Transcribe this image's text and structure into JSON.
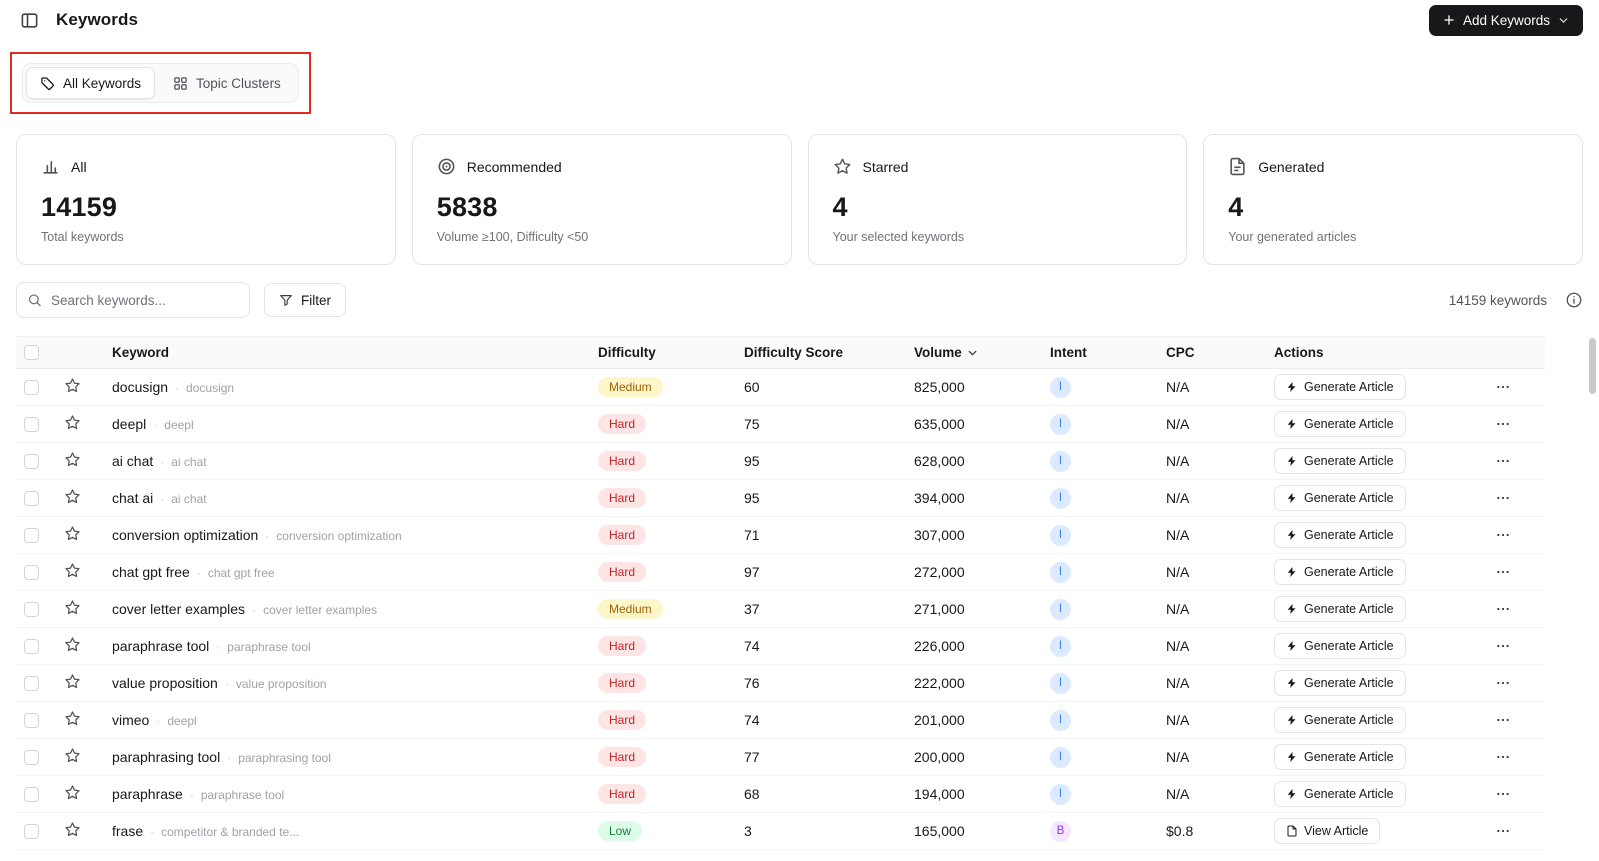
{
  "header": {
    "title": "Keywords",
    "add_keywords_label": "Add Keywords"
  },
  "view_tabs": {
    "all_keywords_label": "All Keywords",
    "topic_clusters_label": "Topic Clusters"
  },
  "stat_cards": [
    {
      "icon": "bar-chart-icon",
      "title": "All",
      "value": "14159",
      "subtitle": "Total keywords"
    },
    {
      "icon": "target-icon",
      "title": "Recommended",
      "value": "5838",
      "subtitle": "Volume ≥100, Difficulty <50"
    },
    {
      "icon": "star-icon",
      "title": "Starred",
      "value": "4",
      "subtitle": "Your selected keywords"
    },
    {
      "icon": "file-icon",
      "title": "Generated",
      "value": "4",
      "subtitle": "Your generated articles"
    }
  ],
  "toolbar": {
    "search_placeholder": "Search keywords...",
    "filter_label": "Filter",
    "keyword_count": "14159 keywords"
  },
  "table": {
    "headers": {
      "keyword": "Keyword",
      "difficulty": "Difficulty",
      "difficulty_score": "Difficulty Score",
      "volume": "Volume",
      "intent": "Intent",
      "cpc": "CPC",
      "actions": "Actions"
    },
    "rows": [
      {
        "keyword": "docusign",
        "cluster": "docusign",
        "difficulty": "Medium",
        "score": "60",
        "volume": "825,000",
        "intent": "I",
        "cpc": "N/A",
        "action": "Generate Article",
        "action_icon": "bolt"
      },
      {
        "keyword": "deepl",
        "cluster": "deepl",
        "difficulty": "Hard",
        "score": "75",
        "volume": "635,000",
        "intent": "I",
        "cpc": "N/A",
        "action": "Generate Article",
        "action_icon": "bolt"
      },
      {
        "keyword": "ai chat",
        "cluster": "ai chat",
        "difficulty": "Hard",
        "score": "95",
        "volume": "628,000",
        "intent": "I",
        "cpc": "N/A",
        "action": "Generate Article",
        "action_icon": "bolt"
      },
      {
        "keyword": "chat ai",
        "cluster": "ai chat",
        "difficulty": "Hard",
        "score": "95",
        "volume": "394,000",
        "intent": "I",
        "cpc": "N/A",
        "action": "Generate Article",
        "action_icon": "bolt"
      },
      {
        "keyword": "conversion optimization",
        "cluster": "conversion optimization",
        "difficulty": "Hard",
        "score": "71",
        "volume": "307,000",
        "intent": "I",
        "cpc": "N/A",
        "action": "Generate Article",
        "action_icon": "bolt"
      },
      {
        "keyword": "chat gpt free",
        "cluster": "chat gpt free",
        "difficulty": "Hard",
        "score": "97",
        "volume": "272,000",
        "intent": "I",
        "cpc": "N/A",
        "action": "Generate Article",
        "action_icon": "bolt"
      },
      {
        "keyword": "cover letter examples",
        "cluster": "cover letter examples",
        "difficulty": "Medium",
        "score": "37",
        "volume": "271,000",
        "intent": "I",
        "cpc": "N/A",
        "action": "Generate Article",
        "action_icon": "bolt"
      },
      {
        "keyword": "paraphrase tool",
        "cluster": "paraphrase tool",
        "difficulty": "Hard",
        "score": "74",
        "volume": "226,000",
        "intent": "I",
        "cpc": "N/A",
        "action": "Generate Article",
        "action_icon": "bolt"
      },
      {
        "keyword": "value proposition",
        "cluster": "value proposition",
        "difficulty": "Hard",
        "score": "76",
        "volume": "222,000",
        "intent": "I",
        "cpc": "N/A",
        "action": "Generate Article",
        "action_icon": "bolt"
      },
      {
        "keyword": "vimeo",
        "cluster": "deepl",
        "difficulty": "Hard",
        "score": "74",
        "volume": "201,000",
        "intent": "I",
        "cpc": "N/A",
        "action": "Generate Article",
        "action_icon": "bolt"
      },
      {
        "keyword": "paraphrasing tool",
        "cluster": "paraphrasing tool",
        "difficulty": "Hard",
        "score": "77",
        "volume": "200,000",
        "intent": "I",
        "cpc": "N/A",
        "action": "Generate Article",
        "action_icon": "bolt"
      },
      {
        "keyword": "paraphrase",
        "cluster": "paraphrase tool",
        "difficulty": "Hard",
        "score": "68",
        "volume": "194,000",
        "intent": "I",
        "cpc": "N/A",
        "action": "Generate Article",
        "action_icon": "bolt"
      },
      {
        "keyword": "frase",
        "cluster": "competitor & branded te...",
        "difficulty": "Low",
        "score": "3",
        "volume": "165,000",
        "intent": "B",
        "cpc": "$0.8",
        "action": "View Article",
        "action_icon": "doc"
      }
    ]
  },
  "colors": {
    "accent_dark": "#18181b",
    "annotation_red": "#e02b20",
    "difficulty_medium_bg": "#fdf6c9",
    "difficulty_medium_text": "#a16207",
    "difficulty_hard_bg": "#fde5e5",
    "difficulty_hard_text": "#c02626",
    "difficulty_low_bg": "#dcfce7",
    "difficulty_low_text": "#15803d",
    "intent_i_bg": "#dbeafe",
    "intent_i_text": "#3b82f6",
    "intent_b_bg": "#f3e8ff",
    "intent_b_text": "#9333ea"
  }
}
